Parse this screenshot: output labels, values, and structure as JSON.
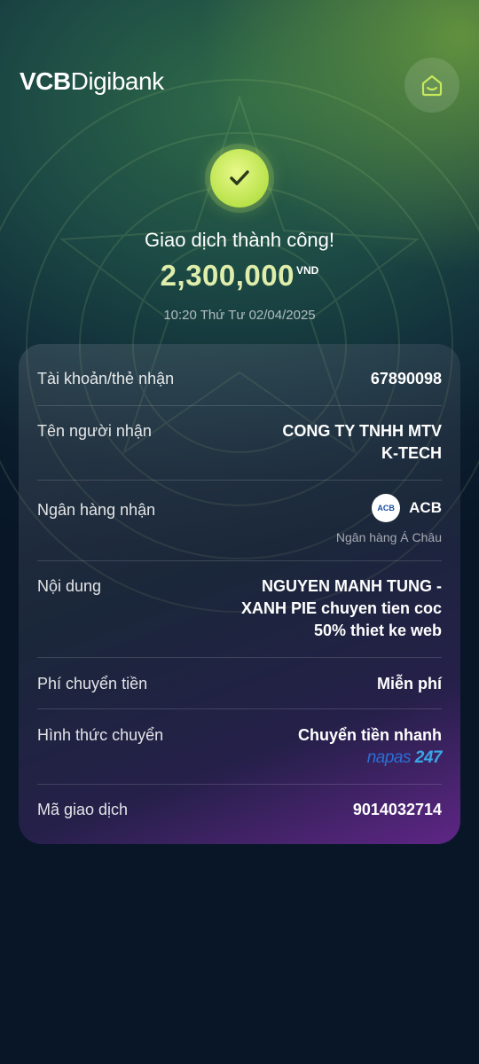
{
  "header": {
    "brand_bold": "VCB",
    "brand_light": "Digibank",
    "home_icon": "home-icon"
  },
  "status": {
    "icon": "check-icon",
    "title": "Giao dịch thành công!",
    "amount": "2,300,000",
    "currency": "VND",
    "datetime": "10:20 Thứ Tư 02/04/2025"
  },
  "details": {
    "account_label": "Tài khoản/thẻ nhận",
    "account_value": "67890098",
    "recipient_label": "Tên người nhận",
    "recipient_line1": "CONG TY TNHH MTV",
    "recipient_line2": "K-TECH",
    "bank_label": "Ngân hàng nhận",
    "bank_logo_text": "ACB",
    "bank_code": "ACB",
    "bank_fullname": "Ngân hàng Á Châu",
    "content_label": "Nội dung",
    "content_line1": "NGUYEN MANH TUNG -",
    "content_line2": "XANH PIE chuyen tien coc",
    "content_line3": "50% thiet ke web",
    "fee_label": "Phí chuyển tiền",
    "fee_value": "Miễn phí",
    "method_label": "Hình thức chuyển",
    "method_value": "Chuyển tiền nhanh",
    "napas_text": "napas",
    "napas_247": "247",
    "txn_label": "Mã giao dịch",
    "txn_value": "9014032714"
  },
  "colors": {
    "accent_green": "#c6e85a",
    "amount_color": "#dfeeaa",
    "card_purple": "#6e2896"
  }
}
